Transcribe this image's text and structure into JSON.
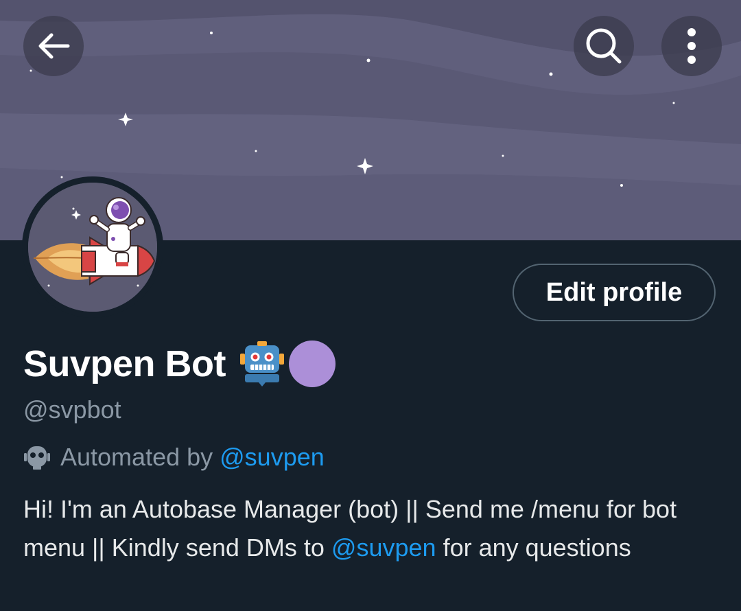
{
  "header": {
    "back_icon": "arrow-left-icon",
    "search_icon": "search-icon",
    "more_icon": "more-vertical-icon"
  },
  "profile": {
    "edit_label": "Edit profile",
    "display_name": "Suvpen Bot",
    "name_emoji": "robot-emoji",
    "name_badge_color": "#ac8fd8",
    "handle": "@svpbot",
    "automated_prefix": "Automated by",
    "automated_by": "@suvpen",
    "bio_part1": "Hi! I'm an Autobase Manager (bot)  || Send me /menu for bot menu || Kindly send DMs to",
    "bio_mention": "@suvpen",
    "bio_part2": "for any questions"
  },
  "colors": {
    "background": "#15202b",
    "accent": "#1d9bf0",
    "secondary_text": "#8b98a5",
    "banner": "#5a5a74"
  }
}
